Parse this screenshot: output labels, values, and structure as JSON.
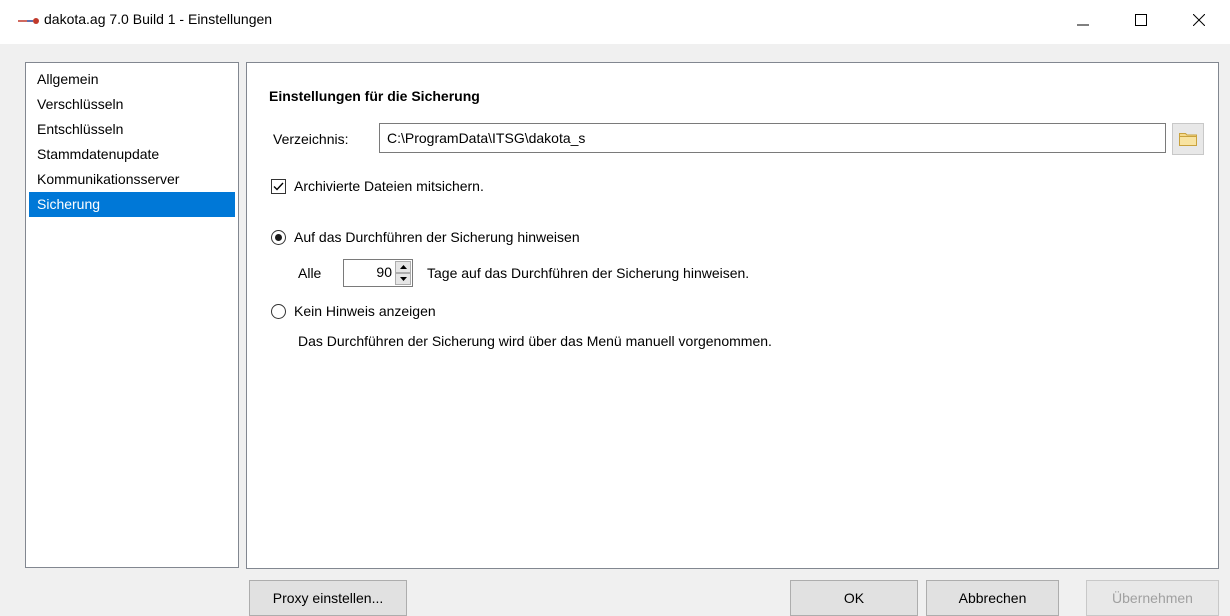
{
  "window": {
    "title": "dakota.ag 7.0 Build 1 - Einstellungen",
    "logo_icon": "dakota-logo-icon",
    "controls": [
      "minimize-icon",
      "maximize-icon",
      "close-icon"
    ]
  },
  "sidebar": {
    "items": [
      {
        "label": "Allgemein"
      },
      {
        "label": "Verschlüsseln"
      },
      {
        "label": "Entschlüsseln"
      },
      {
        "label": "Stammdatenupdate"
      },
      {
        "label": "Kommunikationsserver"
      },
      {
        "label": "Sicherung"
      }
    ],
    "selected_index": 5,
    "selection_color": "#0078d7"
  },
  "panel": {
    "title": "Einstellungen für die Sicherung",
    "directory": {
      "label": "Verzeichnis:",
      "value": "C:\\ProgramData\\ITSG\\dakota_s",
      "browse_icon": "folder-icon"
    },
    "archive_checkbox": {
      "label": "Archivierte Dateien mitsichern.",
      "checked": true
    },
    "reminder_option": {
      "label": "Auf das Durchführen der Sicherung hinweisen",
      "selected": true,
      "prefix": "Alle",
      "days": "90",
      "suffix": "Tage auf das Durchführen der Sicherung hinweisen."
    },
    "no_reminder_option": {
      "label": "Kein Hinweis anzeigen",
      "selected": false,
      "description": "Das Durchführen der Sicherung wird über das Menü manuell vorgenommen."
    }
  },
  "buttons": {
    "proxy": "Proxy einstellen...",
    "ok": "OK",
    "cancel": "Abbrechen",
    "apply": "Übernehmen",
    "apply_enabled": false
  }
}
